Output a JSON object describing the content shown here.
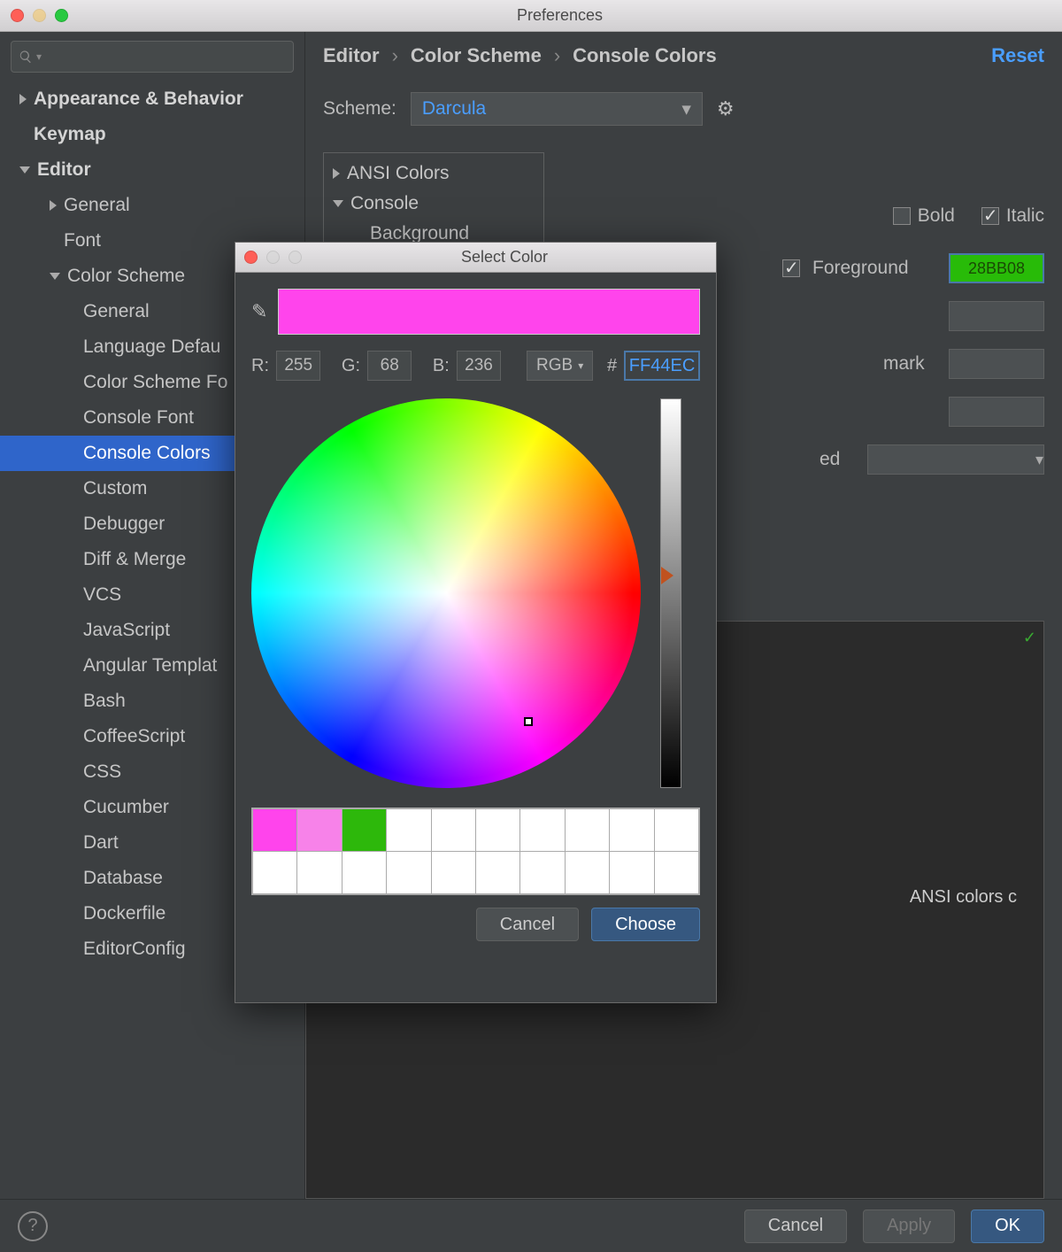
{
  "window": {
    "title": "Preferences"
  },
  "sidebar": {
    "search_placeholder": "",
    "items": [
      {
        "label": "Appearance & Behavior",
        "indent": 0,
        "bold": true,
        "arrow": "closed"
      },
      {
        "label": "Keymap",
        "indent": 0,
        "bold": true,
        "arrow": "none"
      },
      {
        "label": "Editor",
        "indent": 0,
        "bold": true,
        "arrow": "open"
      },
      {
        "label": "General",
        "indent": 1,
        "arrow": "closed"
      },
      {
        "label": "Font",
        "indent": 1,
        "arrow": "none"
      },
      {
        "label": "Color Scheme",
        "indent": 1,
        "arrow": "open"
      },
      {
        "label": "General",
        "indent": 2,
        "arrow": "none"
      },
      {
        "label": "Language Defau",
        "indent": 2,
        "arrow": "none"
      },
      {
        "label": "Color Scheme Fo",
        "indent": 2,
        "arrow": "none"
      },
      {
        "label": "Console Font",
        "indent": 2,
        "arrow": "none"
      },
      {
        "label": "Console Colors",
        "indent": 2,
        "arrow": "none",
        "selected": true
      },
      {
        "label": "Custom",
        "indent": 2,
        "arrow": "none"
      },
      {
        "label": "Debugger",
        "indent": 2,
        "arrow": "none"
      },
      {
        "label": "Diff & Merge",
        "indent": 2,
        "arrow": "none"
      },
      {
        "label": "VCS",
        "indent": 2,
        "arrow": "none"
      },
      {
        "label": "JavaScript",
        "indent": 2,
        "arrow": "none"
      },
      {
        "label": "Angular Templat",
        "indent": 2,
        "arrow": "none"
      },
      {
        "label": "Bash",
        "indent": 2,
        "arrow": "none"
      },
      {
        "label": "CoffeeScript",
        "indent": 2,
        "arrow": "none"
      },
      {
        "label": "CSS",
        "indent": 2,
        "arrow": "none"
      },
      {
        "label": "Cucumber",
        "indent": 2,
        "arrow": "none"
      },
      {
        "label": "Dart",
        "indent": 2,
        "arrow": "none"
      },
      {
        "label": "Database",
        "indent": 2,
        "arrow": "none"
      },
      {
        "label": "Dockerfile",
        "indent": 2,
        "arrow": "none"
      },
      {
        "label": "EditorConfig",
        "indent": 2,
        "arrow": "none"
      }
    ]
  },
  "breadcrumb": {
    "a": "Editor",
    "b": "Color Scheme",
    "c": "Console Colors",
    "reset": "Reset"
  },
  "scheme": {
    "label": "Scheme:",
    "value": "Darcula"
  },
  "tree": {
    "ansi": "ANSI Colors",
    "console": "Console",
    "background": "Background"
  },
  "style": {
    "bold": "Bold",
    "italic": "Italic",
    "foreground": "Foreground",
    "foreground_hex": "28BB08",
    "mark": "mark",
    "ed": "ed"
  },
  "preview": {
    "text": "ANSI colors c"
  },
  "buttons": {
    "cancel": "Cancel",
    "apply": "Apply",
    "ok": "OK"
  },
  "colorpicker": {
    "title": "Select Color",
    "r_label": "R:",
    "r": "255",
    "g_label": "G:",
    "g": "68",
    "b_label": "B:",
    "b": "236",
    "mode": "RGB",
    "hash": "#",
    "hex": "FF44EC",
    "preview_color": "#FF44EC",
    "swatches_row1": [
      "#FF44EC",
      "#F782E9",
      "#2DB80B"
    ],
    "cancel": "Cancel",
    "choose": "Choose"
  }
}
